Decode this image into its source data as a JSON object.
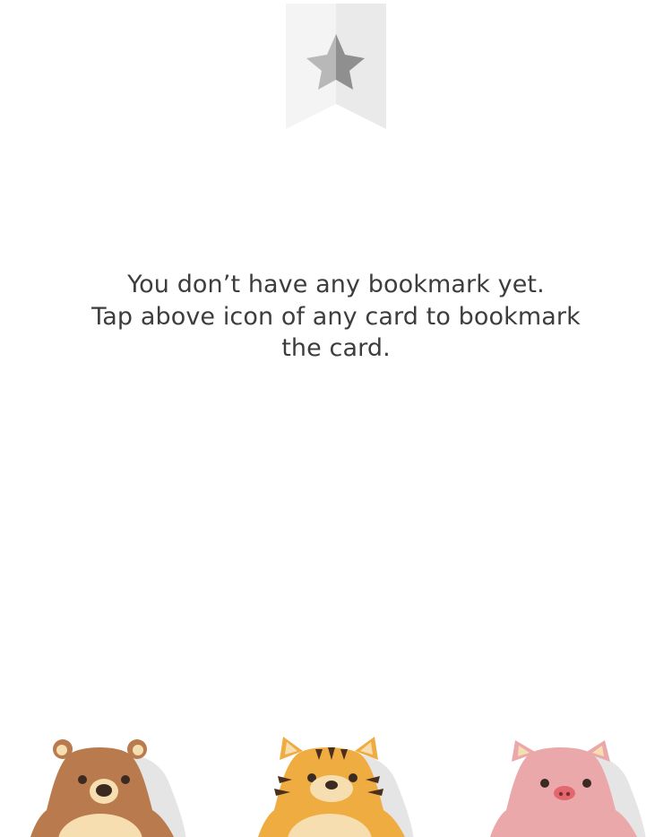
{
  "bookmark_icon": {
    "icon": "bookmark-star-icon",
    "ribbon_color_left": "#f4f4f4",
    "ribbon_color_right": "#eaeaea",
    "star_color_light": "#b8b8b8",
    "star_color_dark": "#8f8f8f"
  },
  "empty_state": {
    "line1": "You don’t have any bookmark yet.",
    "line2": "Tap above icon of any card to bookmark",
    "line3": "the card.",
    "text_color": "#3d3d3d"
  },
  "mascots": [
    {
      "name": "bear-mascot-icon",
      "body_color": "#b97a4d",
      "belly_color": "#f6deb0"
    },
    {
      "name": "tiger-mascot-icon",
      "body_color": "#efad41",
      "belly_color": "#f6deb0"
    },
    {
      "name": "pig-mascot-icon",
      "body_color": "#eba8aa",
      "belly_color": "#eba8aa"
    }
  ]
}
